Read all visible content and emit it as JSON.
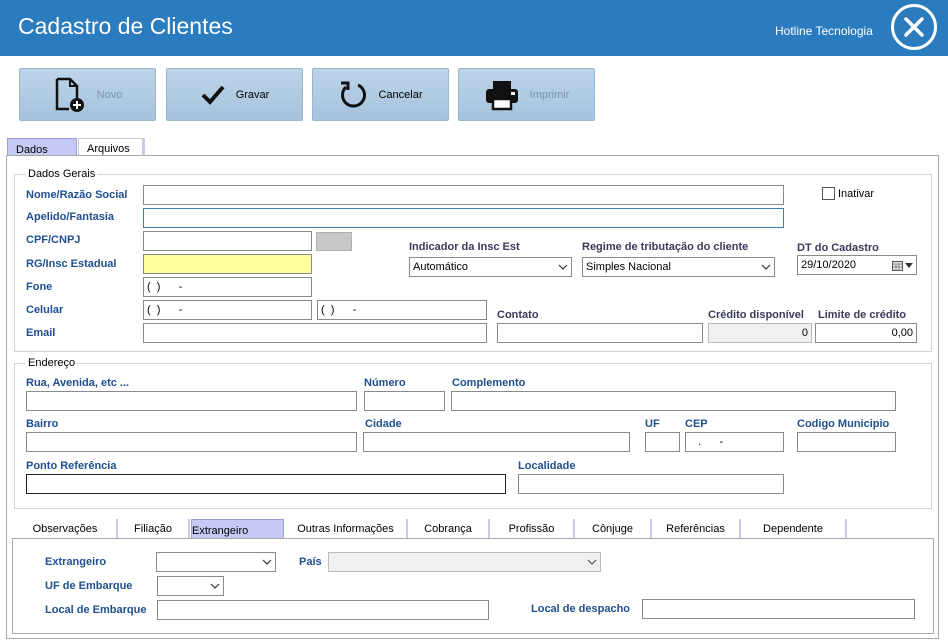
{
  "window": {
    "title": "Cadastro de Clientes",
    "company": "Hotline Tecnologia"
  },
  "toolbar": {
    "novo": "Novo",
    "gravar": "Gravar",
    "cancelar": "Cancelar",
    "imprimir": "Imprimir"
  },
  "tabs": {
    "dados": "Dados",
    "arquivos": "Arquivos"
  },
  "dados_gerais": {
    "title": "Dados Gerais",
    "nome_label": "Nome/Razão Social",
    "apelido_label": "Apelido/Fantasia",
    "cpf_label": "CPF/CNPJ",
    "rg_label": "RG/Insc Estadual",
    "fone_label": "Fone",
    "fone_value": "(  )      -",
    "celular_label": "Celular",
    "celular_value": "(  )      -",
    "celular2_value": "(  )      -",
    "email_label": "Email",
    "inativar_label": "Inativar",
    "indicador_label": "Indicador da Insc Est",
    "indicador_value": "Automático",
    "regime_label": "Regime de tributação do cliente",
    "regime_value": "Simples Nacional",
    "dt_label": "DT do Cadastro",
    "dt_value": "29/10/2020",
    "contato_label": "Contato",
    "credito_label": "Crédito disponível",
    "credito_value": "0",
    "limite_label": "Limite de crédito",
    "limite_value": "0,00"
  },
  "endereco": {
    "title": "Endereço",
    "rua_label": "Rua, Avenida, etc ...",
    "numero_label": "Número",
    "complemento_label": "Complemento",
    "bairro_label": "Bairro",
    "cidade_label": "Cidade",
    "uf_label": "UF",
    "cep_label": "CEP",
    "cep_value": "   .      -",
    "codmun_label": "Codigo Municipio",
    "referencia_label": "Ponto Referência",
    "localidade_label": "Localidade"
  },
  "bottom_tabs": [
    "Observações",
    "Filiação",
    "Extrangeiro",
    "Outras Informações",
    "Cobrança",
    "Profissão",
    "Cônjuge",
    "Referências",
    "Dependente"
  ],
  "extrangeiro": {
    "extrangeiro_label": "Extrangeiro",
    "pais_label": "País",
    "uf_embarque_label": "UF de Embarque",
    "local_embarque_label": "Local de Embarque",
    "local_despacho_label": "Local de despacho"
  }
}
